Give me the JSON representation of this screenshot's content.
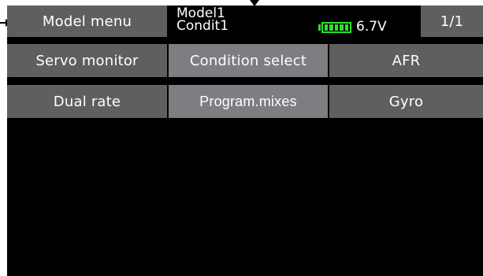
{
  "header": {
    "menu_label": "Model menu",
    "model_name": "Model1",
    "condition_name": "Condit1",
    "battery": {
      "level_fraction": 1.0,
      "voltage": "6.7V",
      "color": "#2ee02e"
    },
    "page_indicator": "1/1"
  },
  "menu": {
    "rows": [
      [
        {
          "label": "Servo monitor",
          "highlighted": false
        },
        {
          "label": "Condition select",
          "highlighted": true
        },
        {
          "label": "AFR",
          "highlighted": false
        }
      ],
      [
        {
          "label": "Dual rate",
          "highlighted": false
        },
        {
          "label": "Program.mixes",
          "highlighted": true
        },
        {
          "label": "Gyro",
          "highlighted": false
        }
      ]
    ]
  },
  "colors": {
    "screen_background": "#000000",
    "button": "#5f5f5f",
    "button_highlighted": "#7d7d82",
    "text": "#ffffff"
  },
  "icons": [
    "pointer-arrow-left",
    "pointer-arrow-down",
    "battery-icon"
  ]
}
